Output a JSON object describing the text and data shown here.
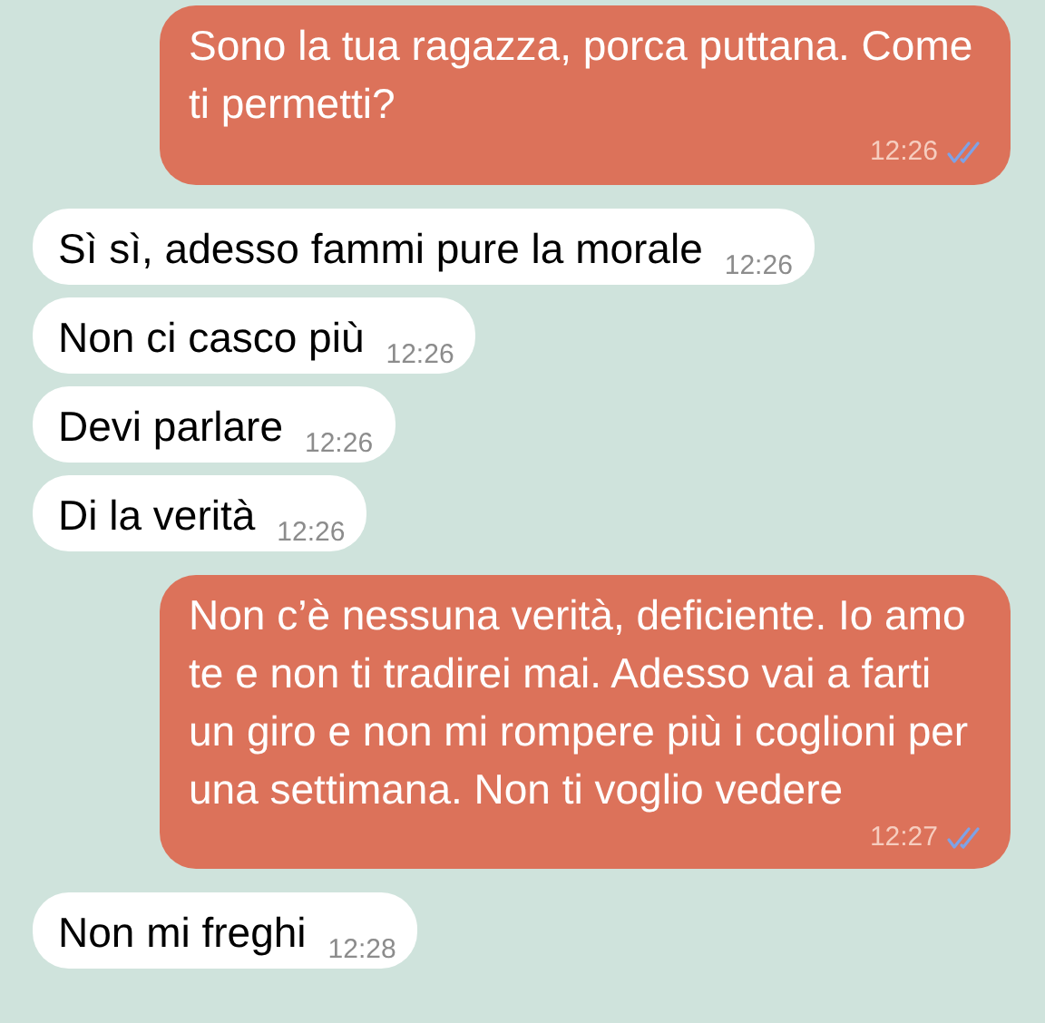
{
  "messages": [
    {
      "kind": "out",
      "text": "Sono la tua ragazza, porca puttana. Come ti permetti?",
      "time": "12:26",
      "read": true
    },
    {
      "kind": "in",
      "text": "Sì sì, adesso fammi pure la morale",
      "time": "12:26"
    },
    {
      "kind": "in",
      "text": "Non ci casco più",
      "time": "12:26"
    },
    {
      "kind": "in",
      "text": "Devi parlare",
      "time": "12:26"
    },
    {
      "kind": "in",
      "text": "Di la verità",
      "time": "12:26"
    },
    {
      "kind": "out",
      "text": "Non c’è nessuna verità, deficiente. Io amo te e non ti tradirei mai. Adesso vai a farti un giro e non mi rompere più i coglioni per una settimana. Non ti voglio vedere",
      "time": "12:27",
      "read": true
    },
    {
      "kind": "in",
      "text": "Non mi freghi",
      "time": "12:28"
    }
  ]
}
